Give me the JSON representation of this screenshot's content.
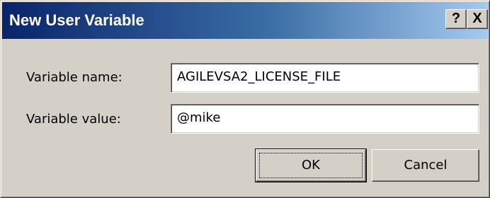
{
  "window": {
    "title": "New User Variable",
    "help_glyph": "?",
    "close_glyph": "X",
    "colors": {
      "titlebar_start": "#0a246a",
      "titlebar_end": "#a6caf0",
      "face": "#d4d0c8"
    }
  },
  "form": {
    "name_label": "Variable name:",
    "name_value": "AGILEVSA2_LICENSE_FILE",
    "value_label": "Variable value:",
    "value_value": "@mike"
  },
  "buttons": {
    "ok_label": "OK",
    "cancel_label": "Cancel"
  }
}
